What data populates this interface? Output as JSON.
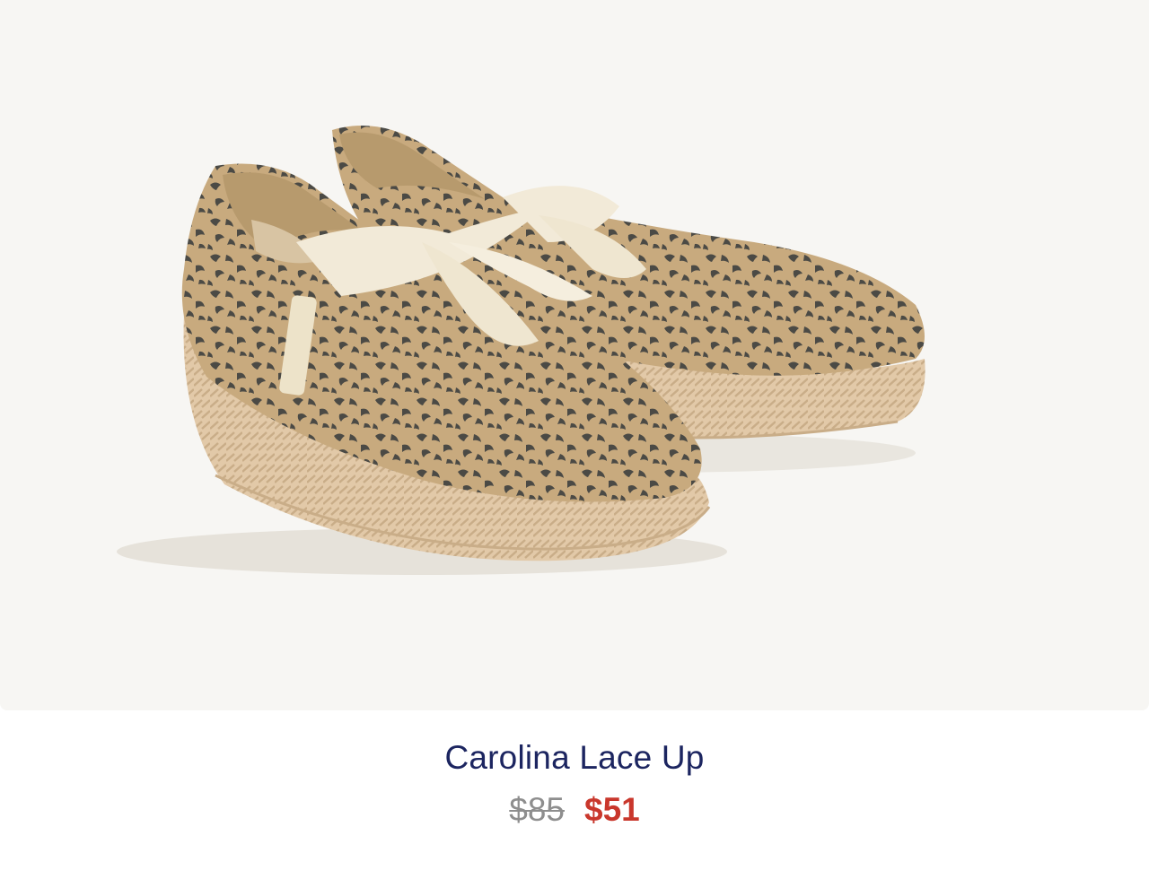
{
  "product": {
    "image_alt": "Carolina Lace Up leopard print espadrille pair",
    "name": "Carolina Lace Up",
    "price_original": "$85",
    "price_sale": "$51"
  },
  "colors": {
    "image_background": "#f7f6f3",
    "title": "#1c2560",
    "price_original": "#8e8e8e",
    "price_sale": "#c9372c"
  }
}
